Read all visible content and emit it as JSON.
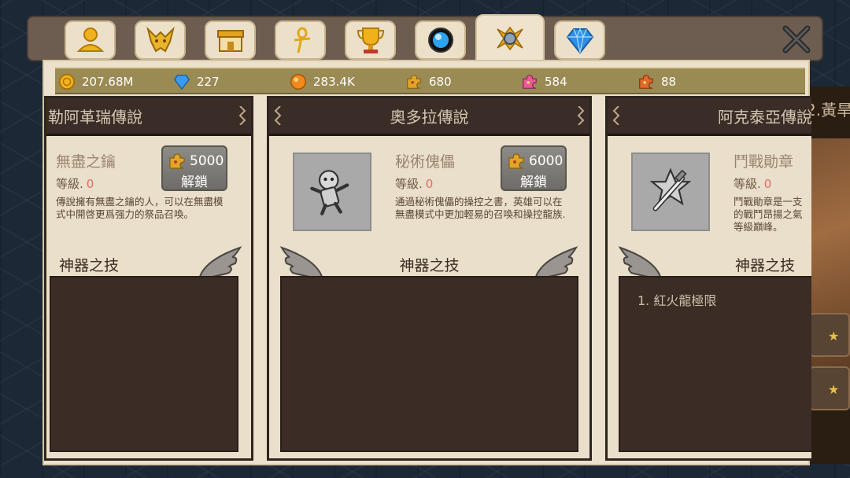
{
  "background": {
    "title": "2.黃旱"
  },
  "tabs": [
    {
      "icon": "profile-icon"
    },
    {
      "icon": "dragon-head-icon"
    },
    {
      "icon": "shop-icon"
    },
    {
      "icon": "ankh-icon"
    },
    {
      "icon": "trophy-icon"
    },
    {
      "icon": "blue-orb-icon"
    },
    {
      "icon": "artifact-icon",
      "active": true
    },
    {
      "icon": "blue-gem-icon"
    }
  ],
  "resources": [
    {
      "icon": "gold-coin-icon",
      "value": "207.68M"
    },
    {
      "icon": "diamond-icon",
      "value": "227"
    },
    {
      "icon": "orange-orb-icon",
      "value": "283.4K"
    },
    {
      "icon": "gold-puzzle-icon",
      "value": "680"
    },
    {
      "icon": "pink-puzzle-icon",
      "value": "584"
    },
    {
      "icon": "red-puzzle-icon",
      "value": "88"
    }
  ],
  "cards": [
    {
      "header": "勒阿革瑞傳說",
      "item_name": "無盡之鑰",
      "level_label": "等級.",
      "level_value": "0",
      "desc_line1": "傳說擁有無盡之鑰的人，可以在無盡模",
      "desc_line2": "式中開啓更爲强力的祭品召喚。",
      "unlock_cost": "5000",
      "unlock_label": "解鎖",
      "skill_title": "神器之技",
      "skills": []
    },
    {
      "header": "奧多拉傳說",
      "item_name": "秘術傀儡",
      "level_label": "等級.",
      "level_value": "0",
      "desc_line1": "通過秘術傀儡的操控之書，英雄可以在",
      "desc_line2": "無盡模式中更加輕易的召喚和操控龍族.",
      "unlock_cost": "6000",
      "unlock_label": "解鎖",
      "skill_title": "神器之技",
      "skills": []
    },
    {
      "header": "阿克泰亞傳說",
      "item_name": "鬥戰勛章",
      "level_label": "等級.",
      "level_value": "0",
      "desc_line1": "鬥戰勛章是一支",
      "desc_line2": "的戰鬥昂揚之氣",
      "desc_line3": "等級巔峰。",
      "skill_title": "神器之技",
      "skills": [
        "1. 紅火龍極限"
      ]
    }
  ],
  "colors": {
    "accent_gold": "#9a8a54",
    "card_bg": "#e9dfca",
    "dark_panel": "#3c2c26",
    "level_red": "#e36b6b"
  }
}
